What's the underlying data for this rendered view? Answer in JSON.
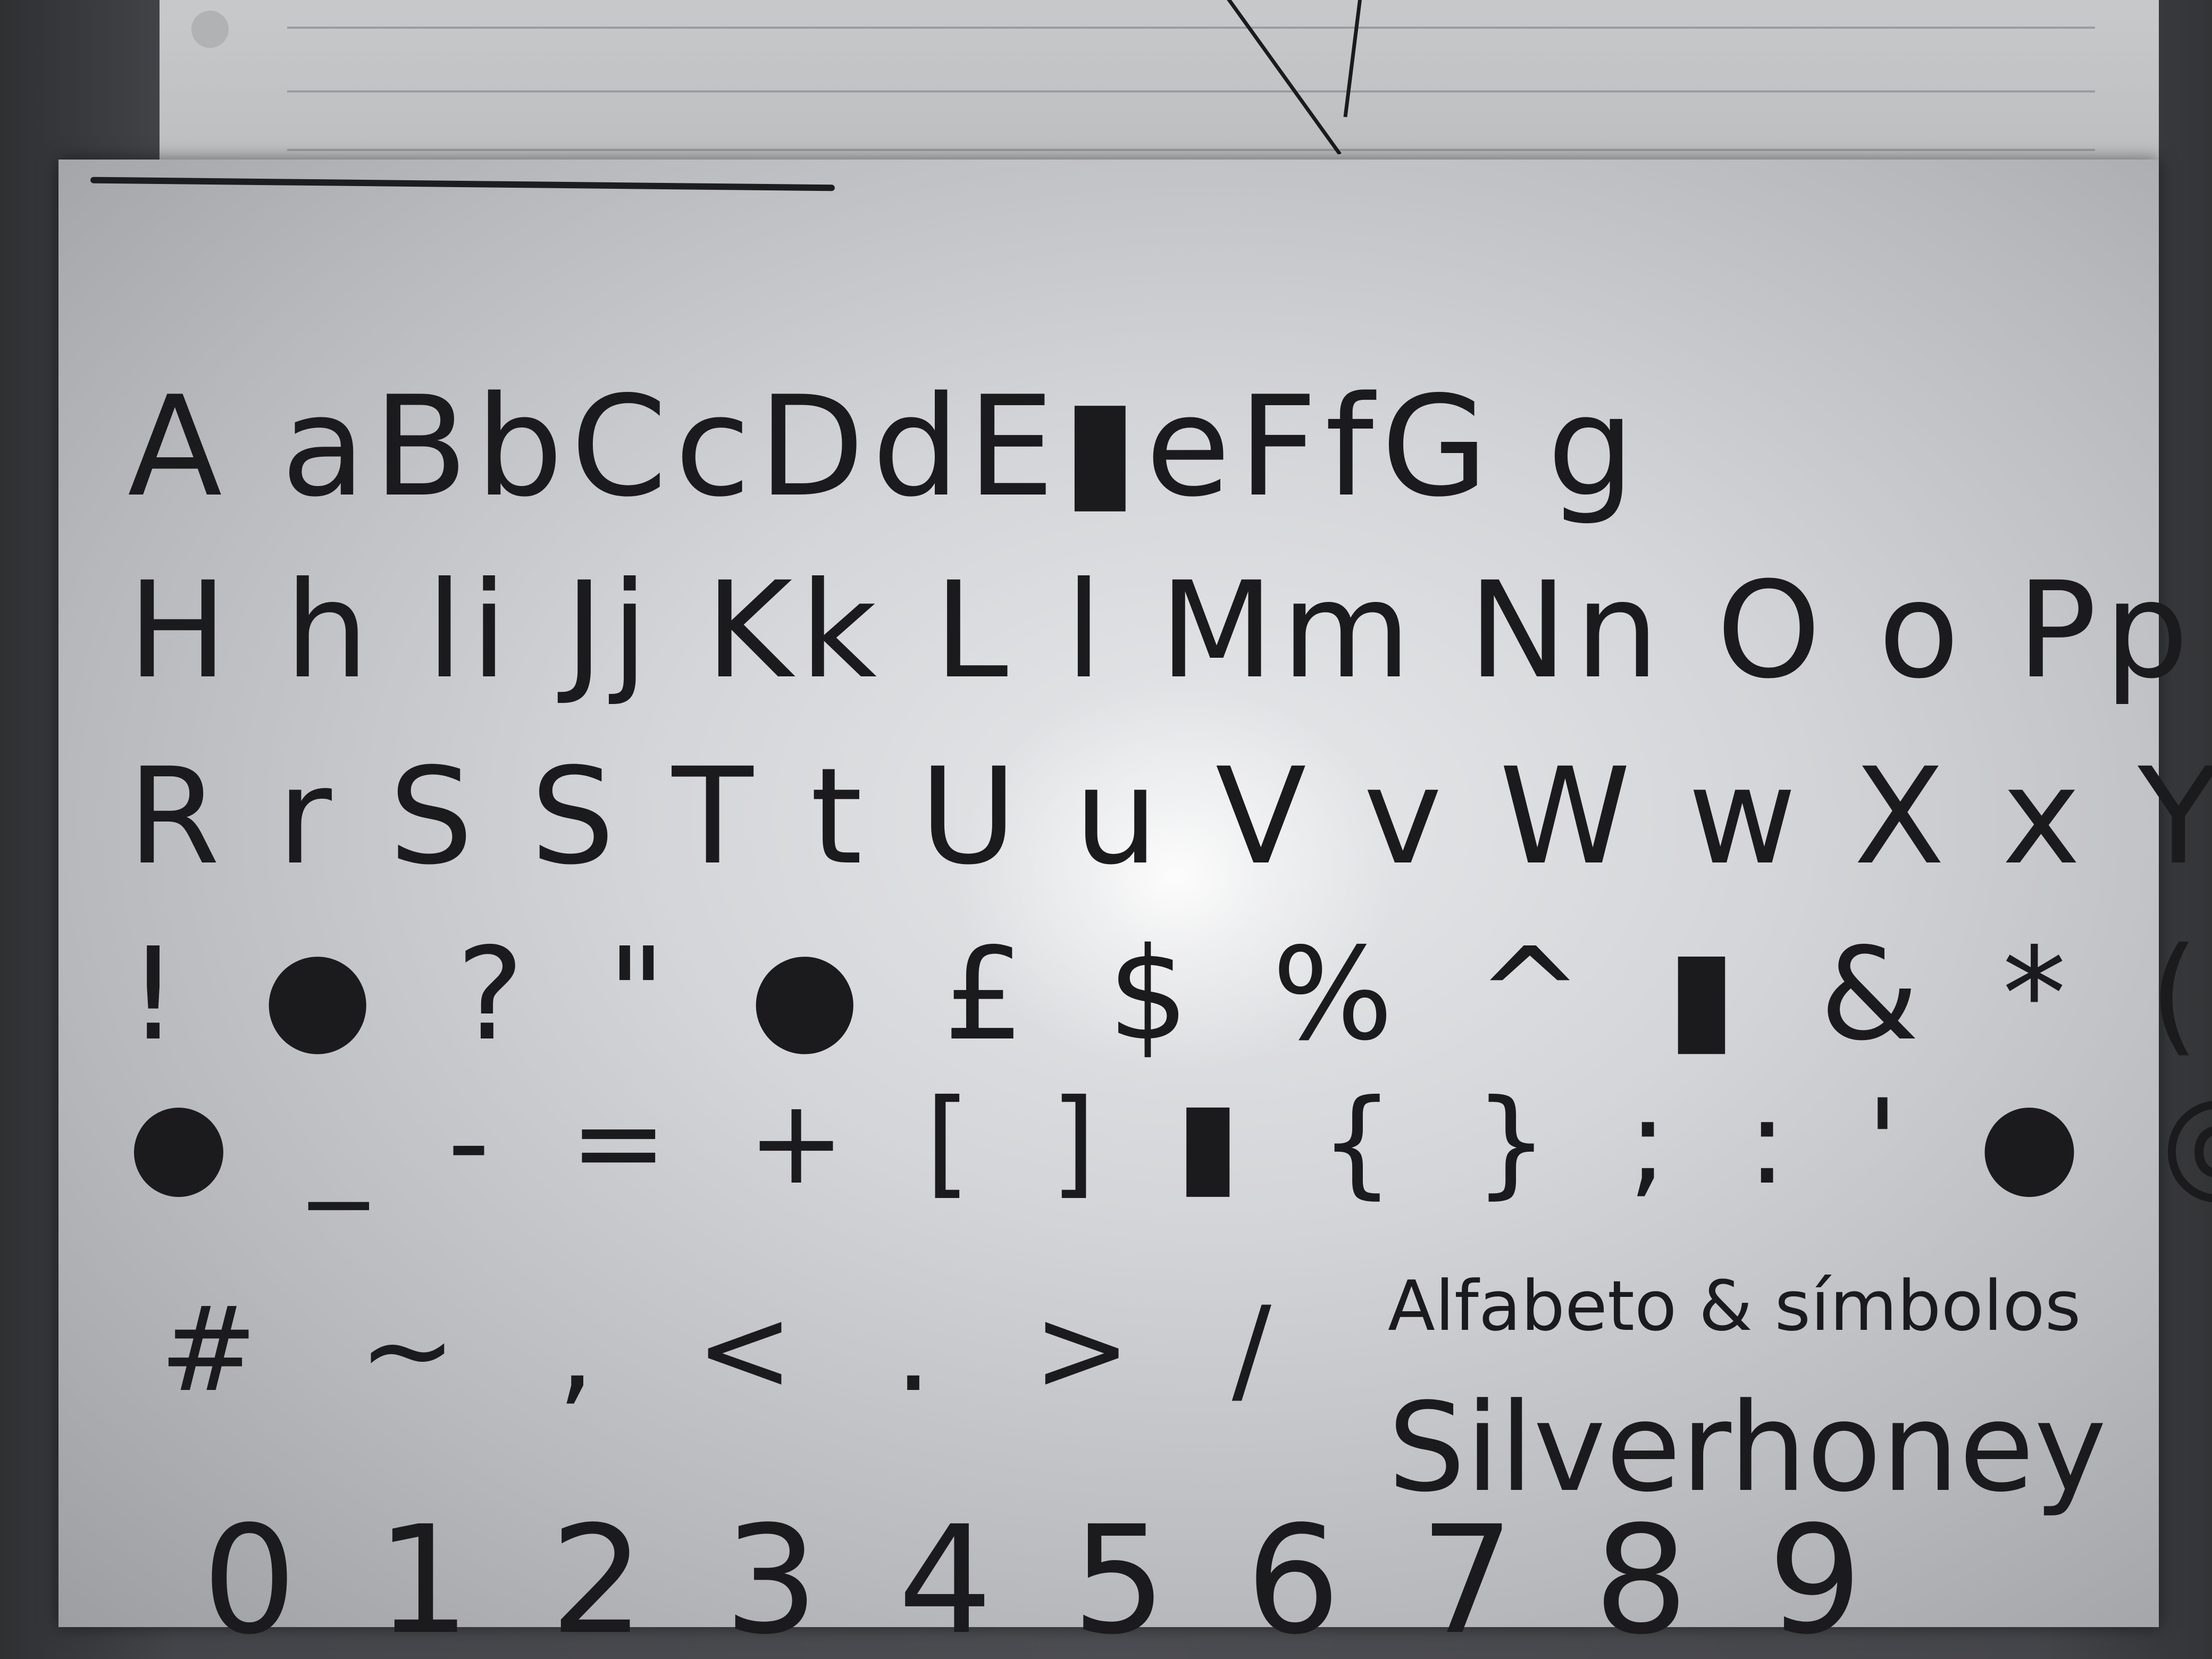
{
  "sheet": {
    "rows": [
      "A aBbCcDdE▮eFfG g",
      "H h li Jj Kk L l Mm Nn O o Pp Q q",
      "R r S S T t U u V v W w X x Y y Z z",
      "! ● ? \" ● £ $ % ^ ▮ & * ( )",
      "● _ - = + [ ] ▮ { } ; : ' ● @ ◉",
      "# ~ , < . > /",
      "0 1 2 3 4 5 6 7 8 9"
    ],
    "caption": {
      "subtitle": "Alfabeto & símbolos",
      "name": "Silverhoney"
    }
  }
}
